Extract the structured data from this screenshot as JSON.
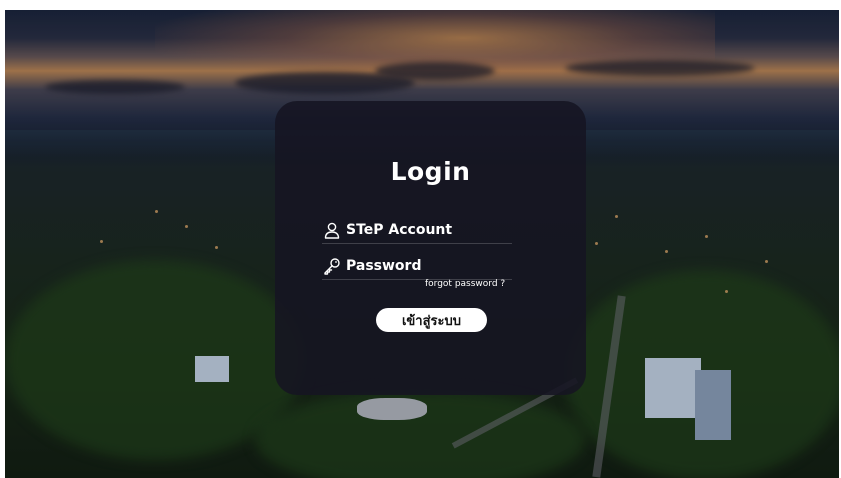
{
  "login": {
    "title": "Login",
    "account_label": "STeP Account",
    "password_label": "Password",
    "forgot_label": "forgot password ?",
    "submit_label": "เข้าสู่ระบบ"
  },
  "icons": {
    "account": "user-icon",
    "password": "key-icon"
  },
  "colors": {
    "panel": "#16142a",
    "text": "#ffffff",
    "button": "#ffffff",
    "button_text": "#111111"
  }
}
